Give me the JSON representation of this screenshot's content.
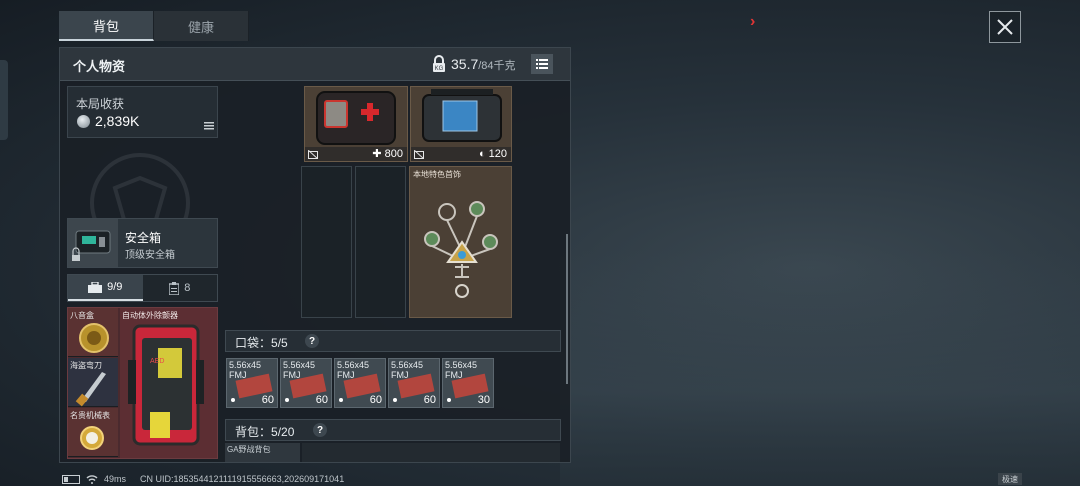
{
  "top_tabs": [
    {
      "label": "背包",
      "active": true
    },
    {
      "label": "健康",
      "active": false
    }
  ],
  "header": {
    "title": "个人物资",
    "weight_current": "35.7",
    "weight_max": "/84千克"
  },
  "earnings": {
    "label": "本局收获",
    "value": "2,839K"
  },
  "safebox": {
    "name": "安全箱",
    "subtitle": "顶级安全箱"
  },
  "sub_tabs": [
    {
      "label": "9/9",
      "icon": "toolbox-icon",
      "active": true
    },
    {
      "label": "8",
      "icon": "clipboard-icon",
      "active": false
    }
  ],
  "equipment": [
    {
      "label": "八音盒"
    },
    {
      "label": "海盗弯刀"
    },
    {
      "label": "名贵机械表"
    }
  ],
  "aed": {
    "label": "自动体外除颤器"
  },
  "items": {
    "medkit": {
      "value": "800"
    },
    "bag": {
      "value": "120"
    },
    "ornament": {
      "name": "本地特色首饰"
    }
  },
  "pocket": {
    "label": "口袋：",
    "count": "5/5"
  },
  "ammo": [
    {
      "name": "5.56x45 FMJ",
      "count": "60"
    },
    {
      "name": "5.56x45 FMJ",
      "count": "60"
    },
    {
      "name": "5.56x45 FMJ",
      "count": "60"
    },
    {
      "name": "5.56x45 FMJ",
      "count": "60"
    },
    {
      "name": "5.56x45 FMJ",
      "count": "30"
    }
  ],
  "backpack": {
    "label": "背包：",
    "count": "5/20",
    "first_item": "GA野战背包"
  },
  "status_bar": {
    "ping": "49ms",
    "uid": "CN UID:1853544121111915556663,202609171041"
  },
  "corner_badge": "极速",
  "colors": {
    "accent_red": "#e03535",
    "panel_bg": "#1a2026",
    "item_bg": "#4b4035"
  }
}
